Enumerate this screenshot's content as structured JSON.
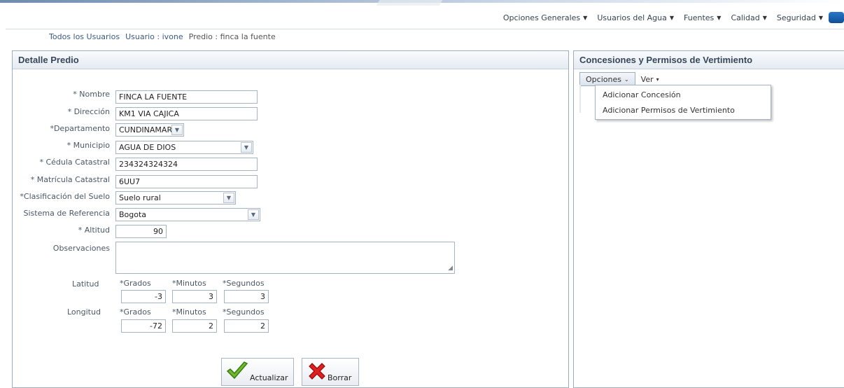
{
  "nav": {
    "items": [
      {
        "label": "Opciones Generales"
      },
      {
        "label": "Usuarios del Agua"
      },
      {
        "label": "Fuentes"
      },
      {
        "label": "Calidad"
      },
      {
        "label": "Seguridad"
      }
    ]
  },
  "breadcrumb": {
    "item0": "Todos los Usuarios",
    "item1": "Usuario : ivone",
    "item2": "Predio : finca la fuente"
  },
  "left_panel": {
    "title": "Detalle Predio",
    "fields": {
      "nombre": {
        "label": "Nombre",
        "value": "FINCA LA FUENTE"
      },
      "direccion": {
        "label": "Dirección",
        "value": "KM1 VIA CAJICA"
      },
      "departamento": {
        "label": "Departamento",
        "value": "CUNDINAMARCA"
      },
      "municipio": {
        "label": "Municipio",
        "value": "AGUA DE DIOS"
      },
      "cedula": {
        "label": "Cédula Catastral",
        "value": "234324324324"
      },
      "matricula": {
        "label": "Matrícula Catastral",
        "value": "6UU7"
      },
      "clasificacion": {
        "label": "Clasificación del Suelo",
        "value": "Suelo rural"
      },
      "sistema": {
        "label": "Sistema de Referencia",
        "value": "Bogota"
      },
      "altitud": {
        "label": "Altitud",
        "value": "90"
      },
      "observaciones": {
        "label": "Observaciones",
        "value": ""
      }
    },
    "coords": {
      "latitud_label": "Latitud",
      "longitud_label": "Longitud",
      "grados_label": "Grados",
      "minutos_label": "Minutos",
      "segundos_label": "Segundos",
      "lat": {
        "grados": "-3",
        "minutos": "3",
        "segundos": "3"
      },
      "lon": {
        "grados": "-72",
        "minutos": "2",
        "segundos": "2"
      }
    },
    "buttons": {
      "actualizar": "Actualizar",
      "borrar": "Borrar"
    }
  },
  "right_panel": {
    "title": "Concesiones y Permisos de Vertimiento",
    "toolbar": {
      "opciones": "Opciones",
      "ver": "Ver"
    },
    "dropdown": {
      "items": [
        {
          "label": "Adicionar Concesión"
        },
        {
          "label": "Adicionar Permisos de Vertimiento"
        }
      ]
    }
  },
  "required_marker": "*",
  "colors": {
    "panel_border": "#9aaec4",
    "header_text": "#37475a",
    "topbar": "#6e8bb0"
  }
}
